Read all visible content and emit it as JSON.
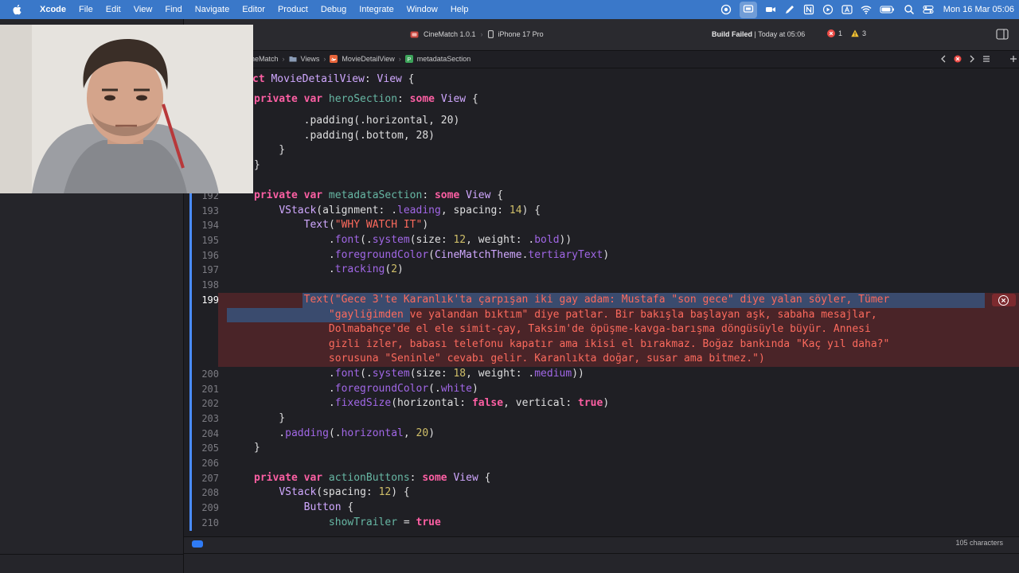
{
  "menubar": {
    "app_name": "Xcode",
    "menus": [
      "File",
      "Edit",
      "View",
      "Find",
      "Navigate",
      "Editor",
      "Product",
      "Debug",
      "Integrate",
      "Window",
      "Help"
    ],
    "clock": "Mon 16 Mar  05:06",
    "status_icons": [
      "screen-record-icon",
      "stage-manager-icon",
      "facetime-icon",
      "pen-icon",
      "notion-icon",
      "play-icon",
      "text-input-icon",
      "wifi-icon",
      "battery-icon",
      "search-icon",
      "control-center-icon"
    ]
  },
  "toolbar": {
    "scheme": "CineMatch 1.0.1",
    "separator": "›",
    "device": "iPhone 17 Pro",
    "status_bold": "Build Failed",
    "status_rest": " | Today at 05:06",
    "error_count": "1",
    "warning_count": "3"
  },
  "jumpbar": {
    "crumbs": [
      "neMatch",
      "Views",
      "MovieDetailView",
      "metadataSection"
    ],
    "sep": "›"
  },
  "statusbar": {
    "characters": "105 characters"
  },
  "colors": {
    "menubar": "#3a78c9",
    "editor_bg": "#1f1f24",
    "keyword": "#fc5fa3",
    "string": "#fc6a5d",
    "number": "#d0bf69",
    "error_bg": "#6e282c",
    "selection": "#3a4b6e",
    "accent": "#2f7bf5"
  },
  "editor": {
    "header": [
      "ct MovieDetailView: View {",
      "private var heroSection: some View {",
      "        .padding(.horizontal, 20)",
      "        .padding(.bottom, 28)",
      "    }",
      "}"
    ],
    "lines": [
      {
        "n": "192",
        "t": "private var metadataSection: some View {"
      },
      {
        "n": "193",
        "t": "    VStack(alignment: .leading, spacing: 14) {"
      },
      {
        "n": "194",
        "t": "        Text(\"WHY WATCH IT\")"
      },
      {
        "n": "195",
        "t": "            .font(.system(size: 12, weight: .bold))"
      },
      {
        "n": "196",
        "t": "            .foregroundColor(CineMatchTheme.tertiaryText)"
      },
      {
        "n": "197",
        "t": "            .tracking(2)"
      },
      {
        "n": "198",
        "t": ""
      },
      {
        "n": "199",
        "t": "        Text(\"Gece 3'te Karanlık'ta çarpışan iki gay adam: Mustafa \"son gece\" diye yalan söyler, Tümer"
      },
      {
        "n": "",
        "t": "            \"gayliğimden ve yalandan bıktım\" diye patlar. Bir bakışla başlayan aşk, sabaha mesajlar,"
      },
      {
        "n": "",
        "t": "            Dolmabahçe'de el ele simit-çay, Taksim'de öpüşme-kavga-barışma döngüsüyle büyür. Annesi"
      },
      {
        "n": "",
        "t": "            gizli izler, babası telefonu kapatır ama ikisi el bırakmaz. Boğaz bankında \"Kaç yıl daha?\""
      },
      {
        "n": "",
        "t": "            sorusuna \"Seninle\" cevabı gelir. Karanlıkta doğar, susar ama bitmez.\")"
      },
      {
        "n": "200",
        "t": "            .font(.system(size: 18, weight: .medium))"
      },
      {
        "n": "201",
        "t": "            .foregroundColor(.white)"
      },
      {
        "n": "202",
        "t": "            .fixedSize(horizontal: false, vertical: true)"
      },
      {
        "n": "203",
        "t": "    }"
      },
      {
        "n": "204",
        "t": "    .padding(.horizontal, 20)"
      },
      {
        "n": "205",
        "t": "}"
      },
      {
        "n": "206",
        "t": ""
      },
      {
        "n": "207",
        "t": "private var actionButtons: some View {"
      },
      {
        "n": "208",
        "t": "    VStack(spacing: 12) {"
      },
      {
        "n": "209",
        "t": "        Button {"
      },
      {
        "n": "210",
        "t": "            showTrailer = true"
      }
    ]
  }
}
